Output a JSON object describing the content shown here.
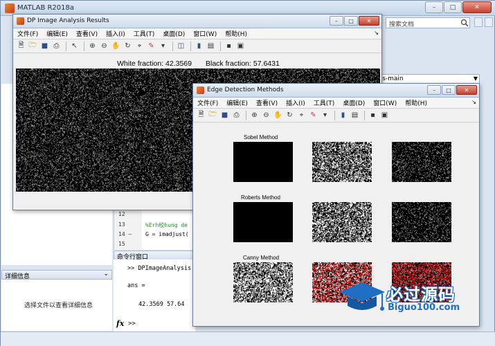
{
  "main_window": {
    "title": "MATLAB R2018a",
    "search_placeholder": "搜索文档",
    "path_text": "sis-main",
    "details_header": "详细信息",
    "details_message": "选择文件以查看详细信息",
    "command_header": "命令行窗口",
    "command_lines": [
      ">> DPImageAnalysis",
      "ans =",
      "42.3569   57.64"
    ],
    "prompt": ">>",
    "fx_label": "fx",
    "editor": {
      "line_numbers": [
        "12",
        "13",
        "14 –",
        "15"
      ],
      "lines": [
        "",
        "%Erh校hung de",
        "G = imadjust(",
        ""
      ]
    }
  },
  "menu_items": [
    "文件(F)",
    "编辑(E)",
    "查看(V)",
    "插入(I)",
    "工具(T)",
    "桌面(D)",
    "窗口(W)",
    "帮助(H)"
  ],
  "figure1": {
    "title": "DP Image Analysis Results",
    "white_fraction_text": "White fraction: 42.3569",
    "black_fraction_text": "Black fraction: 57.6431",
    "white_fraction": 0.423569,
    "black_fraction": 0.576431
  },
  "figure2": {
    "title": "Edge Detection Methods",
    "row_labels": [
      "Sobel Method",
      "Roberts Method",
      "Canny Method"
    ]
  },
  "watermark": {
    "big": "必过源码",
    "small": "Biguo100.com"
  },
  "colors": {
    "window_frame": "#dbe5f1",
    "desktop": "#2d4f6e",
    "overlay_red": "#e02020"
  },
  "icons": [
    "minimize-icon",
    "maximize-icon",
    "close-icon",
    "search-icon",
    "new-file-icon",
    "open-icon",
    "save-icon",
    "print-icon",
    "pointer-icon",
    "zoom-in-icon",
    "zoom-out-icon",
    "pan-icon",
    "rotate-icon",
    "data-cursor-icon",
    "brush-icon",
    "link-icon",
    "colorbar-icon",
    "legend-icon",
    "hide-plot-tools-icon",
    "show-plot-tools-icon"
  ]
}
